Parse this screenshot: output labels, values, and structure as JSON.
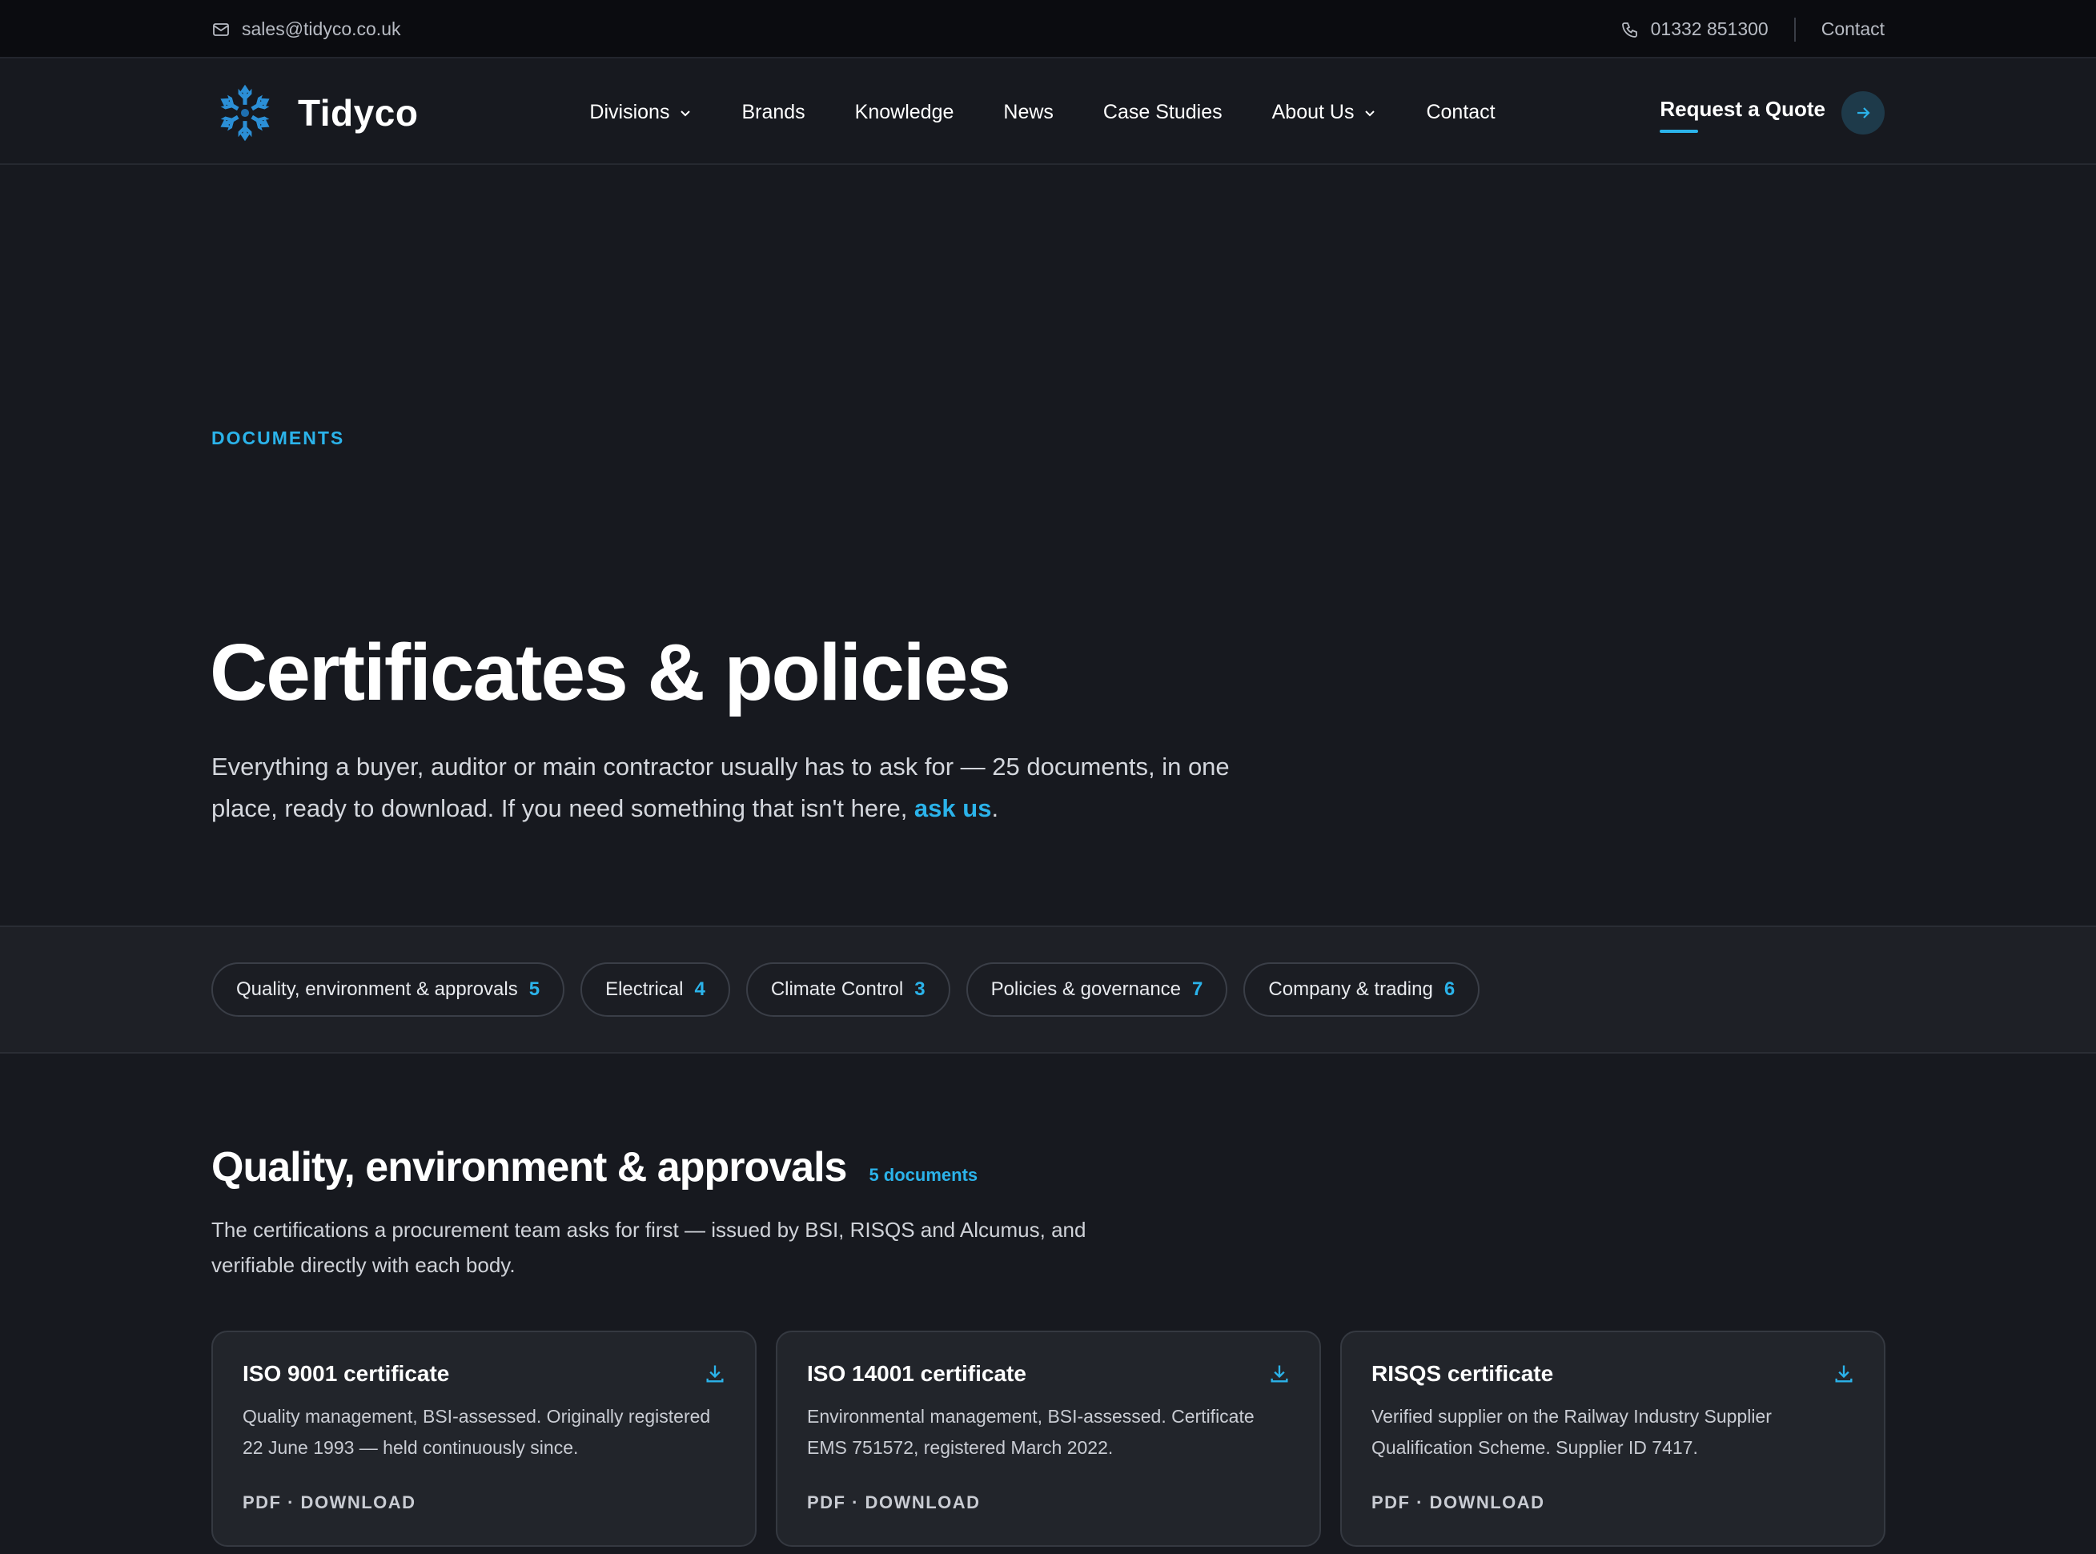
{
  "topbar": {
    "email": "sales@tidyco.co.uk",
    "phone": "01332 851300",
    "contact": "Contact"
  },
  "nav": {
    "logo": "Tidyco",
    "items": [
      {
        "label": "Divisions",
        "dropdown": true
      },
      {
        "label": "Brands",
        "dropdown": false
      },
      {
        "label": "Knowledge",
        "dropdown": false
      },
      {
        "label": "News",
        "dropdown": false
      },
      {
        "label": "Case Studies",
        "dropdown": false
      },
      {
        "label": "About Us",
        "dropdown": true
      },
      {
        "label": "Contact",
        "dropdown": false
      }
    ],
    "cta": "Request a Quote"
  },
  "hero": {
    "eyebrow": "DOCUMENTS",
    "title": "Certificates & policies",
    "intro": "Everything a buyer, auditor or main contractor usually has to ask for — 25 documents, in one place, ready to download. If you need something that isn't here, ",
    "link": "ask us",
    "intro_end": "."
  },
  "filters": [
    {
      "label": "Quality, environment & approvals",
      "count": "5"
    },
    {
      "label": "Electrical",
      "count": "4"
    },
    {
      "label": "Climate Control",
      "count": "3"
    },
    {
      "label": "Policies & governance",
      "count": "7"
    },
    {
      "label": "Company & trading",
      "count": "6"
    }
  ],
  "section": {
    "title": "Quality, environment & approvals",
    "count": "5 documents",
    "description": "The certifications a procurement team asks for first — issued by BSI, RISQS and Alcumus, and verifiable directly with each body."
  },
  "cards": [
    {
      "title": "ISO 9001 certificate",
      "desc": "Quality management, BSI-assessed. Originally registered 22 June 1993 — held continuously since.",
      "footer": "PDF · DOWNLOAD"
    },
    {
      "title": "ISO 14001 certificate",
      "desc": "Environmental management, BSI-assessed. Certificate EMS 751572, registered March 2022.",
      "footer": "PDF · DOWNLOAD"
    },
    {
      "title": "RISQS certificate",
      "desc": "Verified supplier on the Railway Industry Supplier Qualification Scheme. Supplier ID 7417.",
      "footer": "PDF · DOWNLOAD"
    }
  ],
  "colors": {
    "accent": "#2bb3ea",
    "background": "#17191f",
    "topbar": "#0b0c10"
  }
}
